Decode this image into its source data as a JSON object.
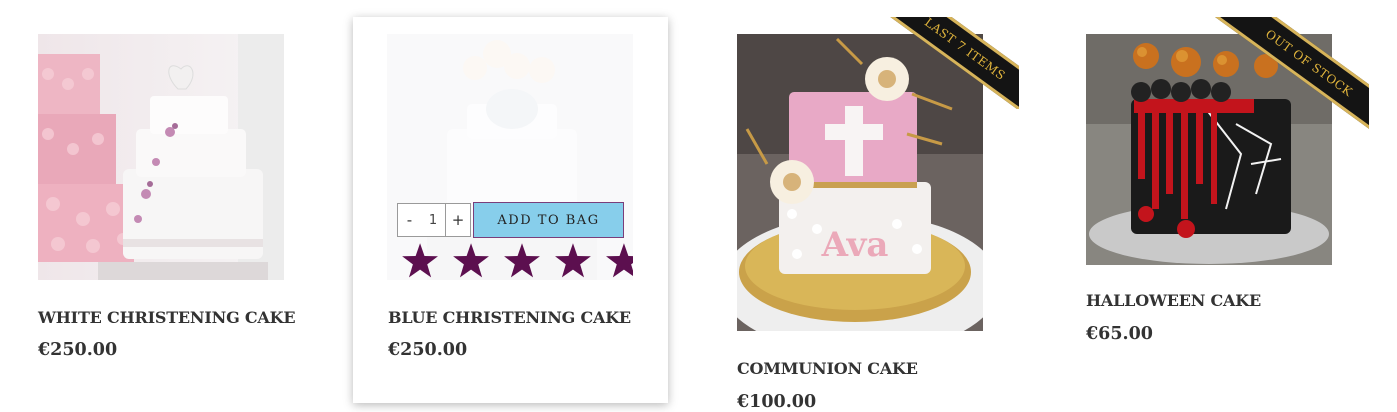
{
  "products": [
    {
      "name": "WHITE CHRISTENING CAKE",
      "price": "€250.00",
      "image_icon": "white-tiered-cake-image"
    },
    {
      "name": "BLUE CHRISTENING CAKE",
      "price": "€250.00",
      "image_icon": "blue-elephant-cake-image",
      "hover": {
        "rating": 5,
        "rating_max": 5,
        "star_color": "#5c0f4f",
        "qty_minus": "-",
        "qty_value": "1",
        "qty_plus": "+",
        "add_label": "ADD TO BAG"
      }
    },
    {
      "name": "COMMUNION CAKE",
      "price": "€100.00",
      "image_icon": "pink-communion-cake-image",
      "cake_lettering": "Ava",
      "ribbon": "LAST 7 ITEMS"
    },
    {
      "name": "HALLOWEEN CAKE",
      "price": "€65.00",
      "image_icon": "halloween-drip-cake-image",
      "ribbon": "OUT OF STOCK"
    }
  ],
  "colors": {
    "accent_purple": "#5c0f4f",
    "button_blue": "#87ceeb",
    "ribbon_gold": "#d7b45a",
    "ribbon_black": "#141414"
  }
}
